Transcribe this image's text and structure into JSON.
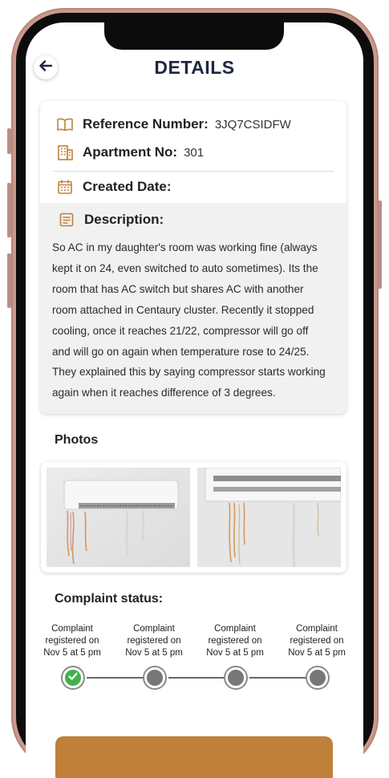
{
  "header": {
    "title": "DETAILS",
    "back_icon": "arrow-left-icon"
  },
  "details": {
    "reference_label": "Reference Number:",
    "reference_value": "3JQ7CSIDFW",
    "apartment_label": "Apartment No:",
    "apartment_value": "301",
    "created_label": "Created Date:",
    "description_label": "Description:",
    "description_lines": [
      "So AC in my daughter's room was working fine (always",
      "kept it on 24, even switched to auto sometimes). Its the",
      "room that has AC switch but shares AC with another",
      "room attached in Centaury cluster. Recently it stopped",
      "cooling, once it reaches 21/22, compressor will go off",
      "and will go on again when temperature rose to 24/25.",
      "They explained this by saying compressor starts working",
      "again when it reaches difference of 3 degrees."
    ]
  },
  "photos": {
    "title": "Photos"
  },
  "status": {
    "title": "Complaint status:",
    "steps": [
      {
        "lines": [
          "Complaint",
          "registered on",
          "Nov 5 at 5 pm"
        ],
        "done": true
      },
      {
        "lines": [
          "Complaint",
          "registered on",
          "Nov 5 at 5 pm"
        ],
        "done": false
      },
      {
        "lines": [
          "Complaint",
          "registered on",
          "Nov 5 at 5 pm"
        ],
        "done": false
      },
      {
        "lines": [
          "Complaint",
          "registered on",
          "Nov 5 at 5 pm"
        ],
        "done": false
      }
    ]
  },
  "colors": {
    "title": "#1f2740",
    "icon_accent": "#c0803a",
    "done": "#3fb24a",
    "pending": "#777777",
    "button": "#c0803a",
    "frame": "#c9998e"
  }
}
